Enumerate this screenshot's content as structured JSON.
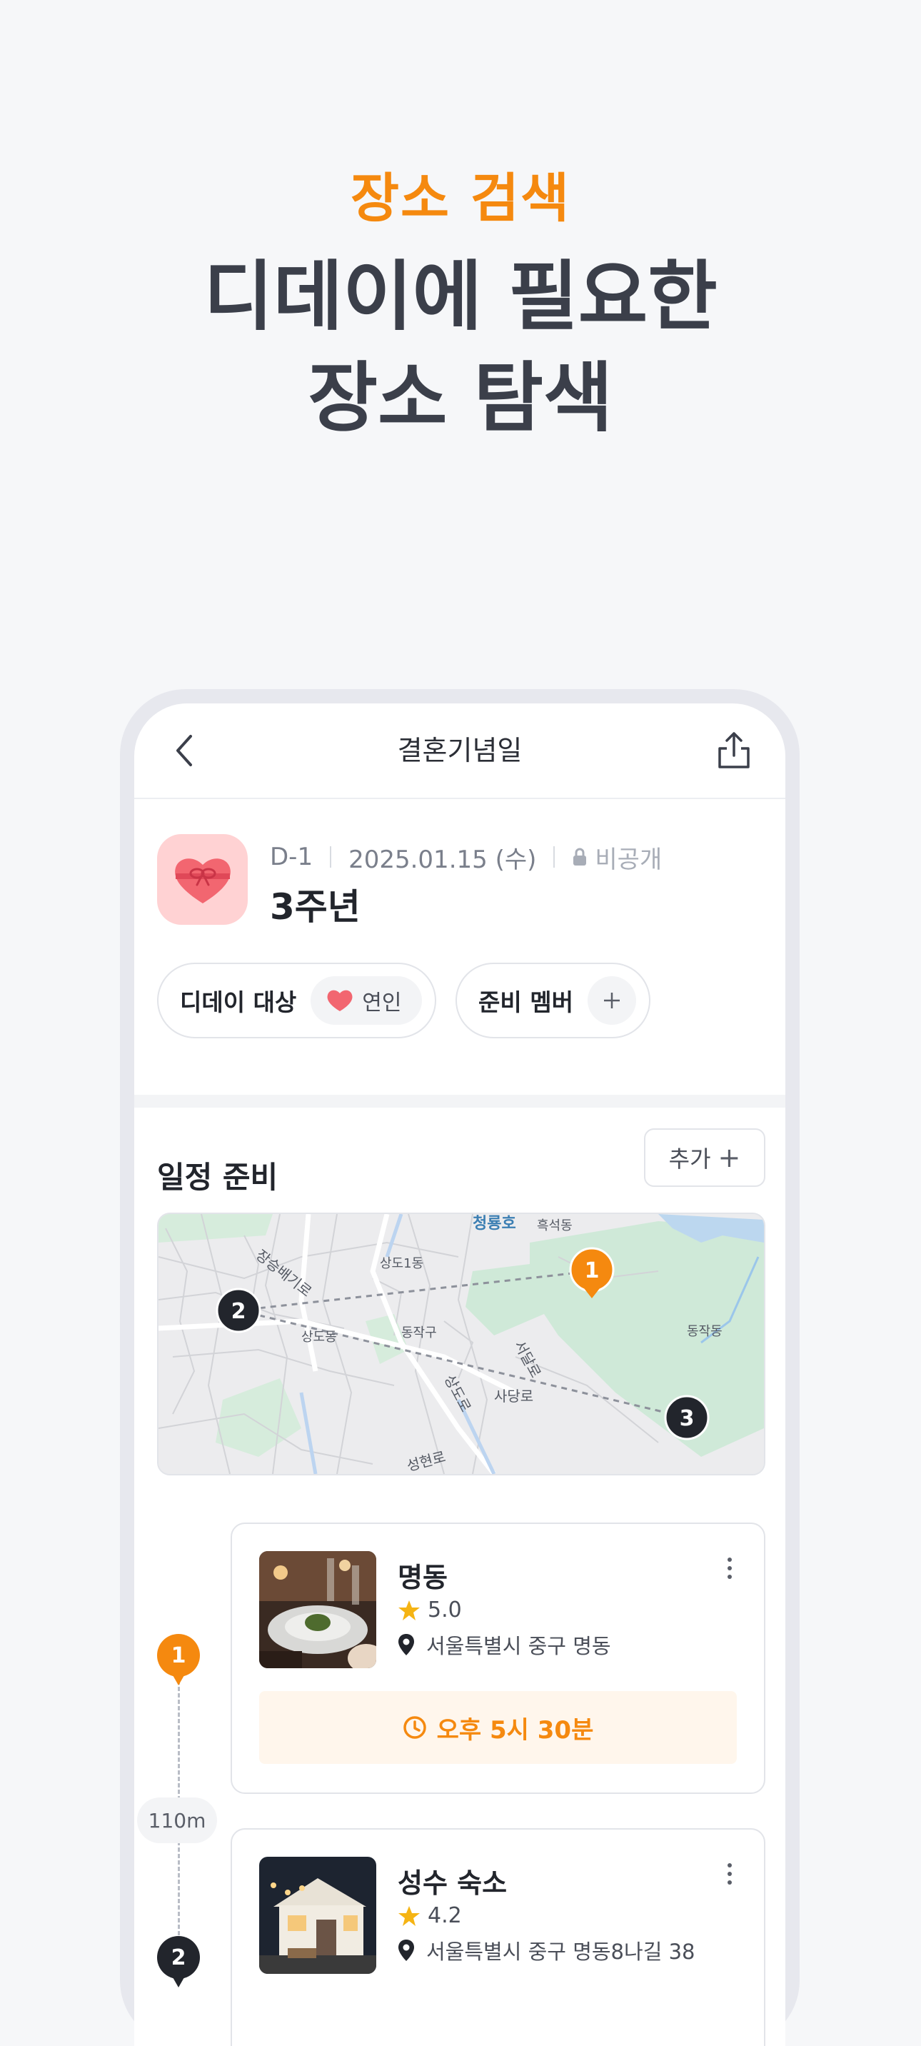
{
  "hero": {
    "eyebrow": "장소 검색",
    "title_line1": "디데이에 필요한",
    "title_line2": "장소 탐색"
  },
  "header": {
    "title": "결혼기념일",
    "back_icon": "chevron-left-icon",
    "share_icon": "share-icon"
  },
  "event": {
    "dday": "D-1",
    "date": "2025.01.15 (수)",
    "visibility": "비공개",
    "name": "3주년",
    "icon": "heart-gift-icon"
  },
  "chips": {
    "target_label": "디데이 대상",
    "target_value": "연인",
    "members_label": "준비 멤버"
  },
  "schedule": {
    "title": "일정 준비",
    "add_label": "추가"
  },
  "map": {
    "labels": [
      "청룡호",
      "흑석동",
      "동작동",
      "상도1동",
      "장승배기로",
      "상도동",
      "동작구",
      "서달로",
      "상도로",
      "사당로",
      "성현로"
    ],
    "pins": [
      "1",
      "2",
      "3"
    ]
  },
  "timeline": {
    "distance": "110m",
    "stops": [
      {
        "index": "1",
        "name": "명동",
        "rating": "5.0",
        "address": "서울특별시 중구 명동",
        "time": "오후 5시 30분"
      },
      {
        "index": "2",
        "name": "성수 숙소",
        "rating": "4.2",
        "address": "서울특별시 중구 명동8나길 38"
      }
    ]
  },
  "colors": {
    "accent": "#f5890f",
    "dark": "#22252c",
    "heart": "#f26670"
  }
}
